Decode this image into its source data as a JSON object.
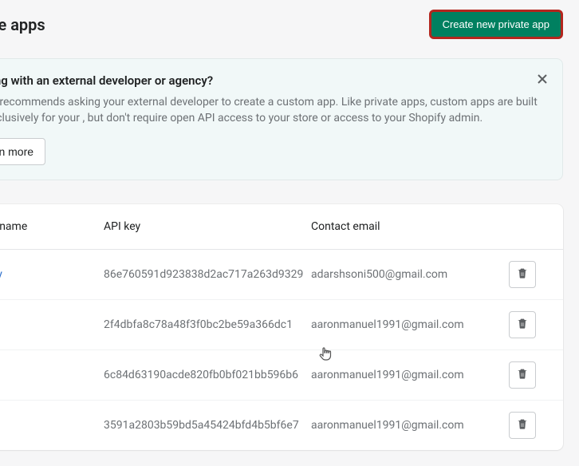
{
  "header": {
    "title": "ate apps",
    "create_label": "Create new private app"
  },
  "banner": {
    "title": "king with an external developer or agency?",
    "body": "ify recommends asking your external developer to create a custom app. Like private apps, custom apps are built exclusively for your , but don't require open API access to your store or access to your Shopify admin.",
    "learn_more": "arn more"
  },
  "table": {
    "headers": {
      "app_name": "pp name",
      "api_key": "API key",
      "contact_email": "Contact email"
    },
    "rows": [
      {
        "name": "oify",
        "api_key": "86e760591d923838d2ac717a263d9329",
        "email": "adarshsoni500@gmail.com",
        "link": true
      },
      {
        "name": "",
        "api_key": "2f4dbfa8c78a48f3f0bc2be59a366dc1",
        "email": "aaronmanuel1991@gmail.com",
        "link": false
      },
      {
        "name": "",
        "api_key": "6c84d63190acde820fb0bf021bb596b6",
        "email": "aaronmanuel1991@gmail.com",
        "link": false
      },
      {
        "name": "",
        "api_key": "3591a2803b59bd5a45424bfd4b5bf6e7",
        "email": "aaronmanuel1991@gmail.com",
        "link": false
      }
    ]
  }
}
